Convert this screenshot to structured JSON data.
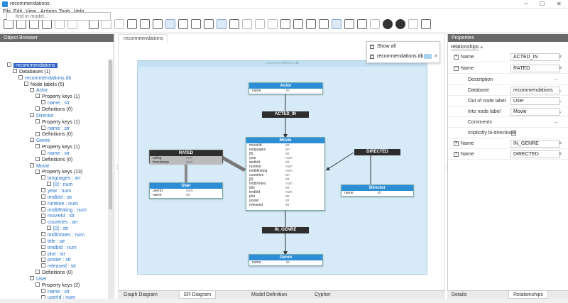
{
  "window": {
    "title": "recommendations",
    "minimize": "─",
    "maximize": "☐",
    "close": "✕"
  },
  "menu": [
    "File",
    "Edit",
    "View",
    "Actions",
    "Tools",
    "Help"
  ],
  "objectBrowser": {
    "title": "Object Browser",
    "searchPlaceholder": "find in model...",
    "tree": [
      {
        "label": "recommendations",
        "selected": true
      },
      {
        "label": "Databases (1)"
      },
      {
        "label": "recommendations.db",
        "blue": true
      },
      {
        "label": "Node labels (5)"
      },
      {
        "label": "Actor",
        "blue": true
      },
      {
        "label": "Property keys (1)"
      },
      {
        "label": "name : str",
        "blue": true
      },
      {
        "label": "Definitions (0)"
      },
      {
        "label": "Director",
        "blue": true
      },
      {
        "label": "Property keys (1)"
      },
      {
        "label": "name : str",
        "blue": true
      },
      {
        "label": "Definitions (0)"
      },
      {
        "label": "Genre",
        "blue": true
      },
      {
        "label": "Property keys (1)"
      },
      {
        "label": "name : str",
        "blue": true
      },
      {
        "label": "Definitions (0)"
      },
      {
        "label": "Movie",
        "blue": true
      },
      {
        "label": "Property keys (13)"
      },
      {
        "label": "languages : arr",
        "blue": true
      },
      {
        "label": "[0] : num",
        "blue": true
      },
      {
        "label": "year : num",
        "blue": true
      },
      {
        "label": "imdbId : str",
        "blue": true
      },
      {
        "label": "runtime : num",
        "blue": true
      },
      {
        "label": "imdbRating : num",
        "blue": true
      },
      {
        "label": "movieId : str",
        "blue": true
      },
      {
        "label": "countries : arr",
        "blue": true
      },
      {
        "label": "[0] : str",
        "blue": true
      },
      {
        "label": "imdbVotes : num",
        "blue": true
      },
      {
        "label": "title : str",
        "blue": true
      },
      {
        "label": "tmdbId : num",
        "blue": true
      },
      {
        "label": "plot : str",
        "blue": true
      },
      {
        "label": "poster : str",
        "blue": true
      },
      {
        "label": "released : str",
        "blue": true
      },
      {
        "label": "Definitions (0)"
      },
      {
        "label": "User",
        "blue": true
      },
      {
        "label": "Property keys (2)"
      },
      {
        "label": "name : str",
        "blue": true
      },
      {
        "label": "userId : num",
        "blue": true
      }
    ]
  },
  "diagram": {
    "tab": "recommendations",
    "canvasTitle": "recommendations.db",
    "popup": {
      "showAll": "Show all",
      "db": "recommendations.db"
    },
    "nodes": {
      "actor": {
        "title": "Actor",
        "props": [
          {
            "n": "name",
            "t": "str"
          }
        ]
      },
      "movie": {
        "title": "Movie",
        "props": [
          {
            "n": "movieId",
            "t": "str"
          },
          {
            "n": "languages",
            "t": "arr"
          },
          {
            "n": "[0]",
            "t": "str"
          },
          {
            "n": "year",
            "t": "num"
          },
          {
            "n": "imdbId",
            "t": "str"
          },
          {
            "n": "runtime",
            "t": "num"
          },
          {
            "n": "imdbRating",
            "t": "num"
          },
          {
            "n": "countries",
            "t": "arr"
          },
          {
            "n": "[0]",
            "t": "str"
          },
          {
            "n": "imdbVotes",
            "t": "num"
          },
          {
            "n": "title",
            "t": "str"
          },
          {
            "n": "tmdbId",
            "t": "num"
          },
          {
            "n": "plot",
            "t": "str"
          },
          {
            "n": "poster",
            "t": "str"
          },
          {
            "n": "released",
            "t": "str"
          }
        ]
      },
      "user": {
        "title": "User",
        "props": [
          {
            "n": "userId",
            "t": "num"
          },
          {
            "n": "name",
            "t": "str"
          }
        ]
      },
      "director": {
        "title": "Director",
        "props": [
          {
            "n": "name",
            "t": "str"
          }
        ]
      },
      "genre": {
        "title": "Genre",
        "props": [
          {
            "n": "name",
            "t": "str"
          }
        ]
      }
    },
    "rels": {
      "actedIn": "ACTED_IN",
      "rated": {
        "title": "RATED",
        "props": [
          {
            "n": "rating",
            "t": "num"
          },
          {
            "n": "timestamp",
            "t": "num"
          }
        ]
      },
      "directed": "DIRECTED",
      "inGenre": "IN_GENRE"
    },
    "bottomTabs": [
      "Graph Diagram",
      "ER Diagram",
      "Model Definition",
      "Cypher"
    ]
  },
  "properties": {
    "title": "Properties",
    "section": "relationships",
    "addSymbol": "+",
    "rows": [
      {
        "label": "Name",
        "value": "ACTED_IN",
        "pm": "+"
      },
      {
        "label": "Name",
        "value": "RATED",
        "pm": "−"
      },
      {
        "label": "Description",
        "value": "..."
      },
      {
        "label": "Database",
        "value": "recommendations"
      },
      {
        "label": "Out of node label",
        "value": "User"
      },
      {
        "label": "Into node label",
        "value": "Movie"
      },
      {
        "label": "Comments",
        "value": "..."
      },
      {
        "label": "Implicitly bi-directional",
        "value": ""
      },
      {
        "label": "Name",
        "value": "IN_GENRE",
        "pm": "+"
      },
      {
        "label": "Name",
        "value": "DIRECTED",
        "pm": "+"
      }
    ],
    "bottomTabs": [
      "Details",
      "Relationships"
    ]
  },
  "colors": {
    "accent": "#2d8ed8",
    "selection": "#2a64c4",
    "canvas": "#d6eaf7"
  }
}
